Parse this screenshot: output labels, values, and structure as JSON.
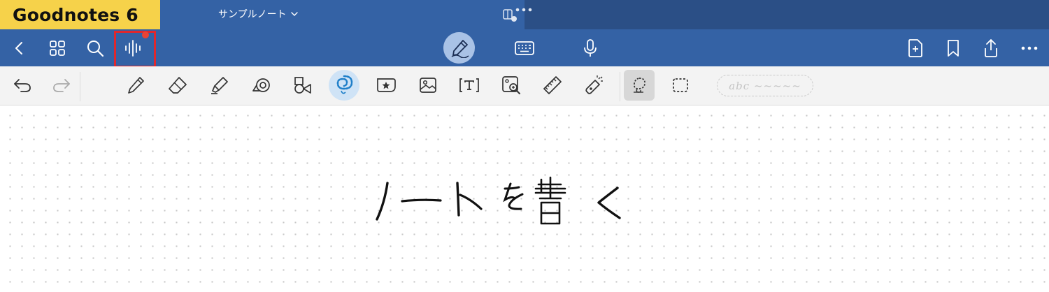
{
  "app_label": "Goodnotes 6",
  "document": {
    "title": "サンプルノート"
  },
  "toolbar_right": [
    "add-page",
    "bookmark",
    "share",
    "more"
  ],
  "annotation": {
    "highlight_color": "#e0272d",
    "label_bg": "#f6d24a"
  },
  "colors": {
    "nav_bg": "#3462a5",
    "toolbar_bg": "#f3f3f3",
    "accent": "#2c8fd6"
  },
  "input_modes": [
    "pen",
    "keyboard",
    "voice"
  ],
  "tools": [
    "pen",
    "eraser",
    "highlighter",
    "tape",
    "shapes",
    "lasso",
    "elements",
    "image",
    "text",
    "camera",
    "ruler",
    "laser-pointer"
  ],
  "selection_modes": [
    "freeform-lasso",
    "rectangle"
  ],
  "abc_pill": {
    "label": "abc ~~~~~"
  },
  "canvas": {
    "handwritten_text": "ノートを書く"
  }
}
